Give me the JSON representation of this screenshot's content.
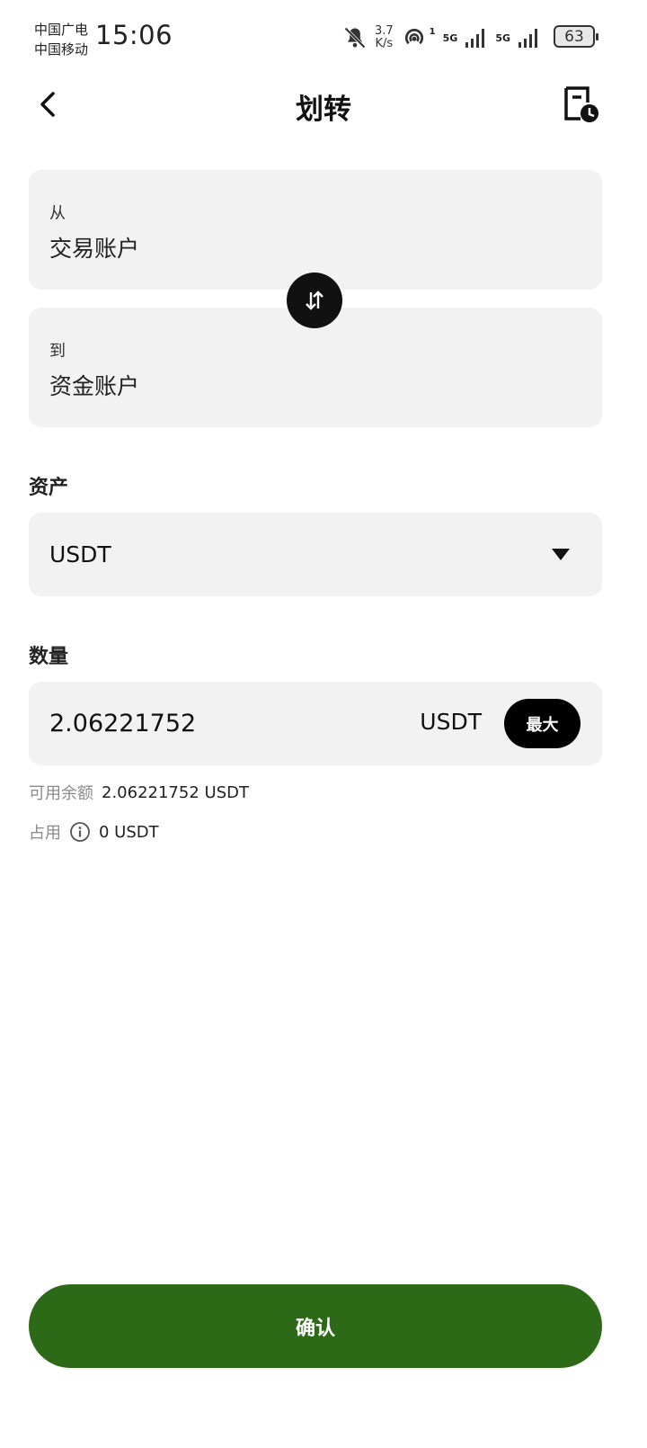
{
  "status_bar": {
    "carrier_1": "中国广电",
    "carrier_2": "中国移动",
    "time": "15:06",
    "net_speed_value": "3.7",
    "net_speed_unit": "K/s",
    "sim1_label": "5G",
    "sim1_index": "1",
    "sim2_label": "5G",
    "battery": "63",
    "icons": [
      "mute-bell-icon",
      "hotspot-icon",
      "signal-bars-icon",
      "battery-icon"
    ]
  },
  "header": {
    "title": "划转",
    "back_icon": "chevron-left-icon",
    "record_icon": "document-clock-icon"
  },
  "transfer": {
    "from_label": "从",
    "from_value": "交易账户",
    "to_label": "到",
    "to_value": "资金账户",
    "swap_icon": "swap-vertical-icon"
  },
  "asset": {
    "label": "资产",
    "selected": "USDT"
  },
  "quantity": {
    "label": "数量",
    "value": "2.06221752",
    "unit": "USDT",
    "max_label": "最大"
  },
  "balance": {
    "available_label": "可用余额",
    "available_value": "2.06221752 USDT",
    "occupied_label": "占用",
    "occupied_value": "0 USDT"
  },
  "confirm_label": "确认",
  "colors": {
    "accent_green": "#2d6a17",
    "card_bg": "#f2f2f2",
    "button_black": "#000000"
  }
}
